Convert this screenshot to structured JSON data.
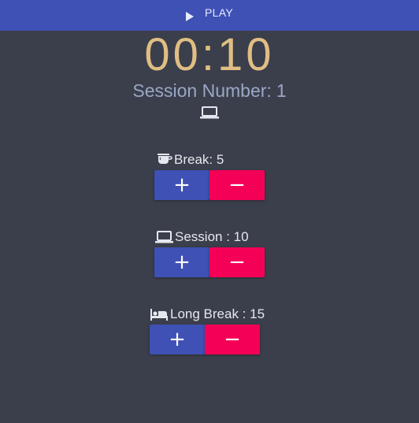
{
  "topbar": {
    "play_label": "PLAY",
    "play_icon": "play-icon",
    "color": "#3f51b5"
  },
  "timer": {
    "display": "00:10",
    "color": "#e0be83"
  },
  "session": {
    "label": "Session Number:",
    "number": "1",
    "mode_icon": "laptop-icon"
  },
  "controls": {
    "break": {
      "label": "Break: 5",
      "icon": "coffee-cup-icon",
      "plus": "+",
      "minus": "−"
    },
    "session": {
      "label": "Session : 10",
      "icon": "laptop-icon",
      "plus": "+",
      "minus": "−"
    },
    "long_break": {
      "label": "Long Break : 15",
      "icon": "bed-icon",
      "plus": "+",
      "minus": "−"
    }
  },
  "colors": {
    "background": "#3b3f4b",
    "plus_button": "#3f51b5",
    "minus_button": "#f50057"
  }
}
